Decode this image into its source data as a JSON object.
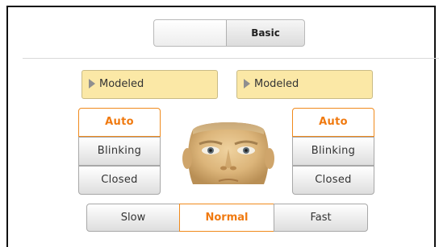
{
  "mode": {
    "label": "Basic"
  },
  "left_eye": {
    "dropdown": "Modeled",
    "options": [
      "Auto",
      "Blinking",
      "Closed"
    ],
    "selected": "Auto"
  },
  "right_eye": {
    "dropdown": "Modeled",
    "options": [
      "Auto",
      "Blinking",
      "Closed"
    ],
    "selected": "Auto"
  },
  "speed": {
    "options": [
      "Slow",
      "Normal",
      "Fast"
    ],
    "selected": "Normal"
  },
  "colors": {
    "accent": "#f07a10",
    "dropdown_bg": "#fbe8a6",
    "button_border": "#a8a8a8"
  },
  "icons": {
    "dropdown": "triangle-right-icon",
    "preview": "face-preview"
  }
}
